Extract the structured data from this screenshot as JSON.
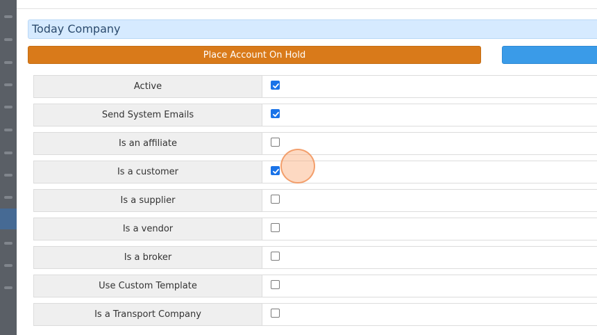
{
  "company": {
    "name": "Today Company"
  },
  "actions": {
    "hold_label": "Place Account On Hold",
    "blue_label": ""
  },
  "settings": [
    {
      "label": "Active",
      "checked": true
    },
    {
      "label": "Send System Emails",
      "checked": true
    },
    {
      "label": "Is an affiliate",
      "checked": false
    },
    {
      "label": "Is a customer",
      "checked": true
    },
    {
      "label": "Is a supplier",
      "checked": false
    },
    {
      "label": "Is a vendor",
      "checked": false
    },
    {
      "label": "Is a broker",
      "checked": false
    },
    {
      "label": "Use Custom Template",
      "checked": false
    },
    {
      "label": "Is a Transport Company",
      "checked": false
    }
  ],
  "colors": {
    "accent_orange": "#d97a1a",
    "accent_blue": "#3a9be8",
    "checkbox_blue": "#1a73e8",
    "title_bg": "#d6eaff"
  }
}
